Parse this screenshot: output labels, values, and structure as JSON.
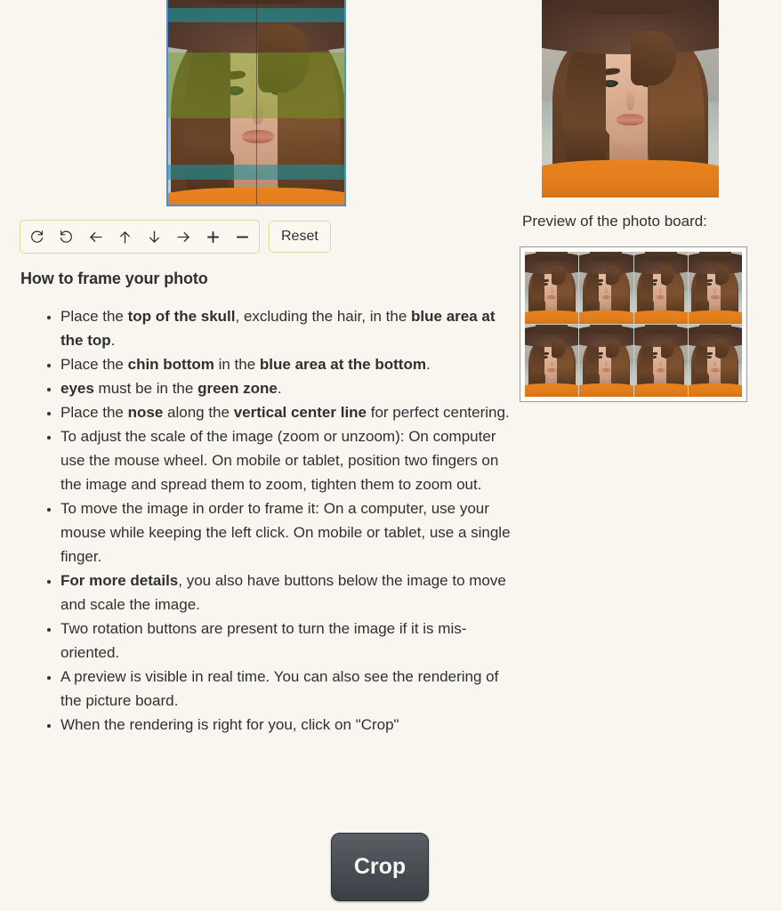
{
  "background_color": "#f9f6ef",
  "editor": {
    "stage_name": "photo-crop-stage",
    "frame_border_color": "#4a90e2",
    "guide_zones": [
      {
        "name": "top-blue-zone",
        "color": "#1a949e",
        "purpose": "top of the skull"
      },
      {
        "name": "green-eye-zone",
        "color": "#76a024",
        "purpose": "eyes"
      },
      {
        "name": "bottom-blue-zone",
        "color": "#1a949e",
        "purpose": "chin bottom"
      }
    ],
    "center_line": {
      "name": "vertical-center-line",
      "color": "#3c281e"
    }
  },
  "toolbar": {
    "group_border_color": "#cfe39a",
    "buttons": [
      {
        "name": "rotate-clockwise-button",
        "icon": "rotate-cw-icon",
        "label": "Rotate clockwise"
      },
      {
        "name": "rotate-counterclockwise-button",
        "icon": "rotate-ccw-icon",
        "label": "Rotate counter-clockwise"
      },
      {
        "name": "move-left-button",
        "icon": "arrow-left-icon",
        "label": "Move left"
      },
      {
        "name": "move-up-button",
        "icon": "arrow-up-icon",
        "label": "Move up"
      },
      {
        "name": "move-down-button",
        "icon": "arrow-down-icon",
        "label": "Move down"
      },
      {
        "name": "move-right-button",
        "icon": "arrow-right-icon",
        "label": "Move right"
      },
      {
        "name": "zoom-in-button",
        "icon": "plus-icon",
        "label": "Zoom in"
      },
      {
        "name": "zoom-out-button",
        "icon": "minus-icon",
        "label": "Zoom out"
      }
    ],
    "reset_label": "Reset"
  },
  "instructions": {
    "heading": "How to frame your photo",
    "items": [
      {
        "parts": [
          {
            "text": "Place the ",
            "bold": false
          },
          {
            "text": "top of the skull",
            "bold": true
          },
          {
            "text": ", excluding the hair, in the ",
            "bold": false
          },
          {
            "text": "blue area at the top",
            "bold": true
          },
          {
            "text": ".",
            "bold": false
          }
        ]
      },
      {
        "parts": [
          {
            "text": "Place the ",
            "bold": false
          },
          {
            "text": "chin bottom",
            "bold": true
          },
          {
            "text": " in the ",
            "bold": false
          },
          {
            "text": "blue area at the bottom",
            "bold": true
          },
          {
            "text": ".",
            "bold": false
          }
        ]
      },
      {
        "parts": [
          {
            "text": "eyes",
            "bold": true
          },
          {
            "text": " must be in the ",
            "bold": false
          },
          {
            "text": "green zone",
            "bold": true
          },
          {
            "text": ".",
            "bold": false
          }
        ]
      },
      {
        "parts": [
          {
            "text": "Place the ",
            "bold": false
          },
          {
            "text": "nose",
            "bold": true
          },
          {
            "text": " along the ",
            "bold": false
          },
          {
            "text": "vertical center line",
            "bold": true
          },
          {
            "text": " for perfect centering.",
            "bold": false
          }
        ]
      },
      {
        "parts": [
          {
            "text": "To adjust the scale of the image (zoom or unzoom): On computer use the mouse wheel. On mobile or tablet, position two fingers on the image and spread them to zoom, tighten them to zoom out.",
            "bold": false
          }
        ]
      },
      {
        "parts": [
          {
            "text": "To move the image in order to frame it: On a computer, use your mouse while keeping the left click. On mobile or tablet, use a single finger.",
            "bold": false
          }
        ]
      },
      {
        "parts": [
          {
            "text": "For more details",
            "bold": true
          },
          {
            "text": ", you also have buttons below the image to move and scale the image.",
            "bold": false
          }
        ]
      },
      {
        "parts": [
          {
            "text": "Two rotation buttons are present to turn the image if it is mis-oriented.",
            "bold": false
          }
        ]
      },
      {
        "parts": [
          {
            "text": "A preview is visible in real time. You can also see the rendering of the picture board.",
            "bold": false
          }
        ]
      },
      {
        "parts": [
          {
            "text": "When the rendering is right for you, click on \"Crop\"",
            "bold": false
          }
        ]
      }
    ]
  },
  "right_panel": {
    "live_preview_name": "live-crop-preview",
    "board_label": "Preview of the photo board:",
    "board_columns": 4,
    "board_rows": 2,
    "board_cell_count": 8
  },
  "crop_action": {
    "label": "Crop"
  }
}
